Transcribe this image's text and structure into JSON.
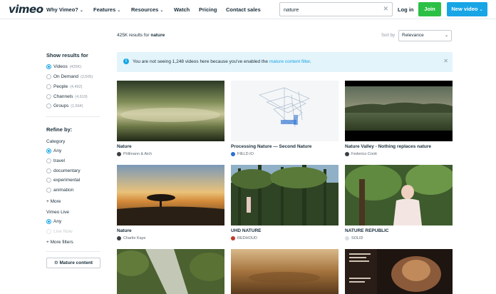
{
  "header": {
    "logo": "vimeo",
    "nav": [
      {
        "label": "Why Vimeo?",
        "dropdown": true
      },
      {
        "label": "Features",
        "dropdown": true
      },
      {
        "label": "Resources",
        "dropdown": true
      },
      {
        "label": "Watch",
        "dropdown": false
      },
      {
        "label": "Pricing",
        "dropdown": false
      },
      {
        "label": "Contact sales",
        "dropdown": false
      }
    ],
    "search_value": "nature",
    "login_label": "Log in",
    "join_label": "Join",
    "new_video_label": "New video",
    "colors": {
      "join": "#2bc045",
      "new_video": "#17a5e6"
    }
  },
  "results": {
    "count_prefix": "425K results for",
    "query": "nature",
    "sort_label": "Sort by",
    "sort_value": "Relevance"
  },
  "sidebar": {
    "show_results_heading": "Show results for",
    "types": [
      {
        "label": "Videos",
        "count": "(425K)",
        "selected": true
      },
      {
        "label": "On Demand",
        "count": "(3,505)",
        "selected": false
      },
      {
        "label": "People",
        "count": "(4,492)",
        "selected": false
      },
      {
        "label": "Channels",
        "count": "(4,619)",
        "selected": false
      },
      {
        "label": "Groups",
        "count": "(1,564)",
        "selected": false
      }
    ],
    "refine_heading": "Refine by:",
    "category_heading": "Category",
    "categories": [
      {
        "label": "Any",
        "selected": true
      },
      {
        "label": "travel",
        "selected": false
      },
      {
        "label": "documentary",
        "selected": false
      },
      {
        "label": "experimental",
        "selected": false
      },
      {
        "label": "animation",
        "selected": false
      }
    ],
    "more_label": "+ More",
    "live_heading": "Vimeo Live",
    "live_options": [
      {
        "label": "Any",
        "selected": true,
        "disabled": false
      },
      {
        "label": "Live Now",
        "selected": false,
        "disabled": true
      }
    ],
    "more_filters_label": "+ More filters",
    "mature_label": "Mature content"
  },
  "notice": {
    "text": "You are not seeing 1,248 videos here because you've enabled the",
    "link": "mature content filter",
    "suffix": "."
  },
  "videos": [
    {
      "title": "Nature",
      "user": "Pöllmann & Aich"
    },
    {
      "title": "Processing Nature — Second Nature",
      "user": "FIELD.IO"
    },
    {
      "title": "Nature Valley - Nothing replaces nature",
      "user": "Federico Conti"
    },
    {
      "title": "Nature",
      "user": "Charlie Kaye"
    },
    {
      "title": "UHD NATURE",
      "user": "REDHOUD"
    },
    {
      "title": "NATURE REPUBLIC",
      "user": "SOLID"
    },
    {
      "title": "",
      "user": ""
    },
    {
      "title": "",
      "user": ""
    },
    {
      "title": "",
      "user": ""
    }
  ]
}
